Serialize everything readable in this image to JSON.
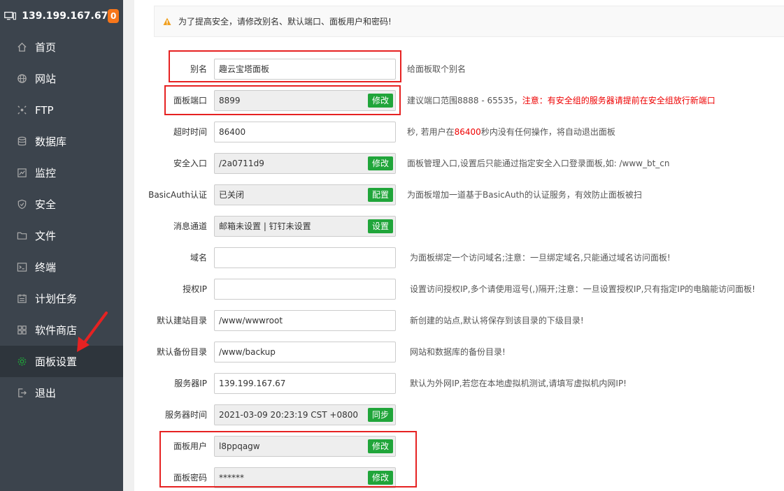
{
  "sidebar": {
    "ip": "139.199.167.67",
    "badge": "0",
    "items": [
      {
        "label": "首页",
        "icon": "home-icon"
      },
      {
        "label": "网站",
        "icon": "globe-icon"
      },
      {
        "label": "FTP",
        "icon": "ftp-icon"
      },
      {
        "label": "数据库",
        "icon": "database-icon"
      },
      {
        "label": "监控",
        "icon": "monitor-icon"
      },
      {
        "label": "安全",
        "icon": "shield-icon"
      },
      {
        "label": "文件",
        "icon": "folder-icon"
      },
      {
        "label": "终端",
        "icon": "terminal-icon"
      },
      {
        "label": "计划任务",
        "icon": "calendar-icon"
      },
      {
        "label": "软件商店",
        "icon": "apps-icon"
      },
      {
        "label": "面板设置",
        "icon": "gear-icon",
        "active": true
      },
      {
        "label": "退出",
        "icon": "logout-icon"
      }
    ]
  },
  "notice": "为了提高安全，请修改别名、默认端口、面板用户和密码!",
  "form": {
    "alias": {
      "label": "别名",
      "value": "趣云宝塔面板",
      "hint": "给面板取个别名"
    },
    "port": {
      "label": "面板端口",
      "value": "8899",
      "button": "修改",
      "hint": "建议端口范围8888 - 65535，",
      "hint_red": "注意：有安全组的服务器请提前在安全组放行新端口"
    },
    "timeout": {
      "label": "超时时间",
      "value": "86400",
      "hint_a": "秒, 若用户在",
      "hint_red": "86400",
      "hint_b": "秒内没有任何操作，将自动退出面板"
    },
    "entry": {
      "label": "安全入口",
      "value": "/2a0711d9",
      "button": "修改",
      "hint": "面板管理入口,设置后只能通过指定安全入口登录面板,如: /www_bt_cn"
    },
    "basicauth": {
      "label": "BasicAuth认证",
      "value": "已关闭",
      "button": "配置",
      "hint": "为面板增加一道基于BasicAuth的认证服务，有效防止面板被扫"
    },
    "message": {
      "label": "消息通道",
      "value": "邮箱未设置 | 钉钉未设置",
      "button": "设置"
    },
    "domain": {
      "label": "域名",
      "value": "",
      "hint": "为面板绑定一个访问域名;注意：一旦绑定域名,只能通过域名访问面板!"
    },
    "authip": {
      "label": "授权IP",
      "value": "",
      "hint": "设置访问授权IP,多个请使用逗号(,)隔开;注意：一旦设置授权IP,只有指定IP的电脑能访问面板!"
    },
    "sitedir": {
      "label": "默认建站目录",
      "value": "/www/wwwroot",
      "hint": "新创建的站点,默认将保存到该目录的下级目录!"
    },
    "backupdir": {
      "label": "默认备份目录",
      "value": "/www/backup",
      "hint": "网站和数据库的备份目录!"
    },
    "serverip": {
      "label": "服务器IP",
      "value": "139.199.167.67",
      "hint": "默认为外网IP,若您在本地虚拟机测试,请填写虚拟机内网IP!"
    },
    "servertime": {
      "label": "服务器时间",
      "value": "2021-03-09 20:23:19 CST +0800",
      "button": "同步"
    },
    "user": {
      "label": "面板用户",
      "value": "l8ppqagw",
      "button": "修改"
    },
    "password": {
      "label": "面板密码",
      "value": "******",
      "button": "修改"
    }
  },
  "colors": {
    "accent": "#20a53a",
    "sidebar": "#3c444d",
    "highlight": "#e62222",
    "badge": "#f7761a"
  }
}
